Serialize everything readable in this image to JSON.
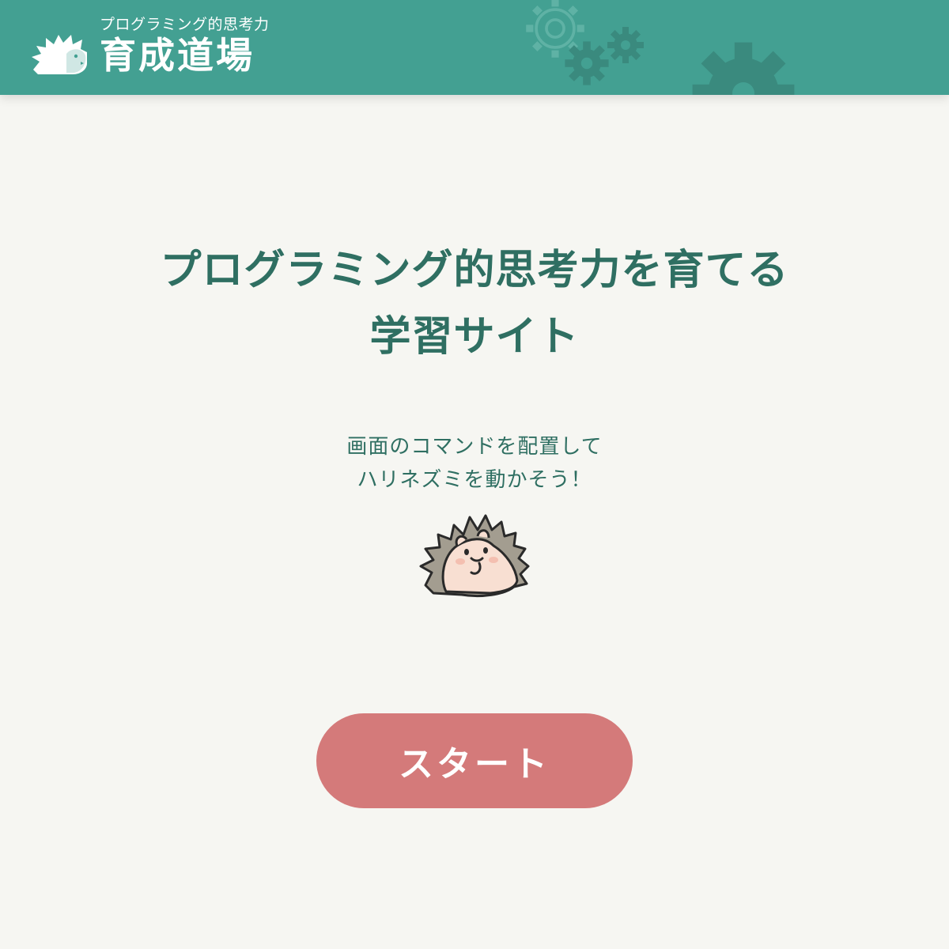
{
  "header": {
    "logo_subtitle": "プログラミング的思考力",
    "logo_title": "育成道場",
    "bg_color": "#43a092"
  },
  "main": {
    "title_line1": "プログラミング的思考力を育てる",
    "title_line2": "学習サイト",
    "description_line1": "画面のコマンドを配置して",
    "description_line2": "ハリネズミを動かそう！",
    "start_label": "スタート",
    "start_color": "#d47a7a",
    "text_color": "#2f6f62"
  }
}
